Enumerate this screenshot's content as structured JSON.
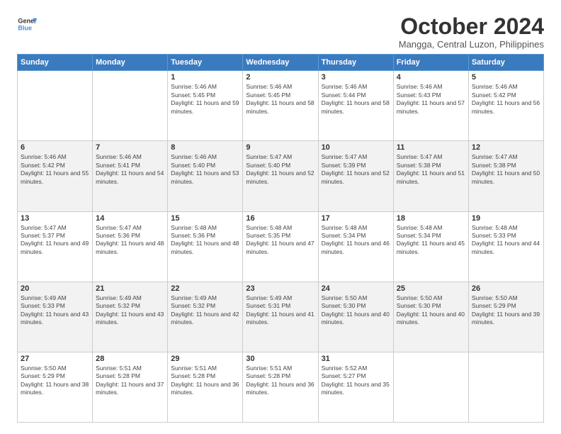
{
  "header": {
    "logo_line1": "General",
    "logo_line2": "Blue",
    "month": "October 2024",
    "location": "Mangga, Central Luzon, Philippines"
  },
  "weekdays": [
    "Sunday",
    "Monday",
    "Tuesday",
    "Wednesday",
    "Thursday",
    "Friday",
    "Saturday"
  ],
  "weeks": [
    [
      {
        "day": "",
        "info": ""
      },
      {
        "day": "",
        "info": ""
      },
      {
        "day": "1",
        "info": "Sunrise: 5:46 AM\nSunset: 5:45 PM\nDaylight: 11 hours and 59 minutes."
      },
      {
        "day": "2",
        "info": "Sunrise: 5:46 AM\nSunset: 5:45 PM\nDaylight: 11 hours and 58 minutes."
      },
      {
        "day": "3",
        "info": "Sunrise: 5:46 AM\nSunset: 5:44 PM\nDaylight: 11 hours and 58 minutes."
      },
      {
        "day": "4",
        "info": "Sunrise: 5:46 AM\nSunset: 5:43 PM\nDaylight: 11 hours and 57 minutes."
      },
      {
        "day": "5",
        "info": "Sunrise: 5:46 AM\nSunset: 5:42 PM\nDaylight: 11 hours and 56 minutes."
      }
    ],
    [
      {
        "day": "6",
        "info": "Sunrise: 5:46 AM\nSunset: 5:42 PM\nDaylight: 11 hours and 55 minutes."
      },
      {
        "day": "7",
        "info": "Sunrise: 5:46 AM\nSunset: 5:41 PM\nDaylight: 11 hours and 54 minutes."
      },
      {
        "day": "8",
        "info": "Sunrise: 5:46 AM\nSunset: 5:40 PM\nDaylight: 11 hours and 53 minutes."
      },
      {
        "day": "9",
        "info": "Sunrise: 5:47 AM\nSunset: 5:40 PM\nDaylight: 11 hours and 52 minutes."
      },
      {
        "day": "10",
        "info": "Sunrise: 5:47 AM\nSunset: 5:39 PM\nDaylight: 11 hours and 52 minutes."
      },
      {
        "day": "11",
        "info": "Sunrise: 5:47 AM\nSunset: 5:38 PM\nDaylight: 11 hours and 51 minutes."
      },
      {
        "day": "12",
        "info": "Sunrise: 5:47 AM\nSunset: 5:38 PM\nDaylight: 11 hours and 50 minutes."
      }
    ],
    [
      {
        "day": "13",
        "info": "Sunrise: 5:47 AM\nSunset: 5:37 PM\nDaylight: 11 hours and 49 minutes."
      },
      {
        "day": "14",
        "info": "Sunrise: 5:47 AM\nSunset: 5:36 PM\nDaylight: 11 hours and 48 minutes."
      },
      {
        "day": "15",
        "info": "Sunrise: 5:48 AM\nSunset: 5:36 PM\nDaylight: 11 hours and 48 minutes."
      },
      {
        "day": "16",
        "info": "Sunrise: 5:48 AM\nSunset: 5:35 PM\nDaylight: 11 hours and 47 minutes."
      },
      {
        "day": "17",
        "info": "Sunrise: 5:48 AM\nSunset: 5:34 PM\nDaylight: 11 hours and 46 minutes."
      },
      {
        "day": "18",
        "info": "Sunrise: 5:48 AM\nSunset: 5:34 PM\nDaylight: 11 hours and 45 minutes."
      },
      {
        "day": "19",
        "info": "Sunrise: 5:48 AM\nSunset: 5:33 PM\nDaylight: 11 hours and 44 minutes."
      }
    ],
    [
      {
        "day": "20",
        "info": "Sunrise: 5:49 AM\nSunset: 5:33 PM\nDaylight: 11 hours and 43 minutes."
      },
      {
        "day": "21",
        "info": "Sunrise: 5:49 AM\nSunset: 5:32 PM\nDaylight: 11 hours and 43 minutes."
      },
      {
        "day": "22",
        "info": "Sunrise: 5:49 AM\nSunset: 5:32 PM\nDaylight: 11 hours and 42 minutes."
      },
      {
        "day": "23",
        "info": "Sunrise: 5:49 AM\nSunset: 5:31 PM\nDaylight: 11 hours and 41 minutes."
      },
      {
        "day": "24",
        "info": "Sunrise: 5:50 AM\nSunset: 5:30 PM\nDaylight: 11 hours and 40 minutes."
      },
      {
        "day": "25",
        "info": "Sunrise: 5:50 AM\nSunset: 5:30 PM\nDaylight: 11 hours and 40 minutes."
      },
      {
        "day": "26",
        "info": "Sunrise: 5:50 AM\nSunset: 5:29 PM\nDaylight: 11 hours and 39 minutes."
      }
    ],
    [
      {
        "day": "27",
        "info": "Sunrise: 5:50 AM\nSunset: 5:29 PM\nDaylight: 11 hours and 38 minutes."
      },
      {
        "day": "28",
        "info": "Sunrise: 5:51 AM\nSunset: 5:28 PM\nDaylight: 11 hours and 37 minutes."
      },
      {
        "day": "29",
        "info": "Sunrise: 5:51 AM\nSunset: 5:28 PM\nDaylight: 11 hours and 36 minutes."
      },
      {
        "day": "30",
        "info": "Sunrise: 5:51 AM\nSunset: 5:28 PM\nDaylight: 11 hours and 36 minutes."
      },
      {
        "day": "31",
        "info": "Sunrise: 5:52 AM\nSunset: 5:27 PM\nDaylight: 11 hours and 35 minutes."
      },
      {
        "day": "",
        "info": ""
      },
      {
        "day": "",
        "info": ""
      }
    ]
  ]
}
